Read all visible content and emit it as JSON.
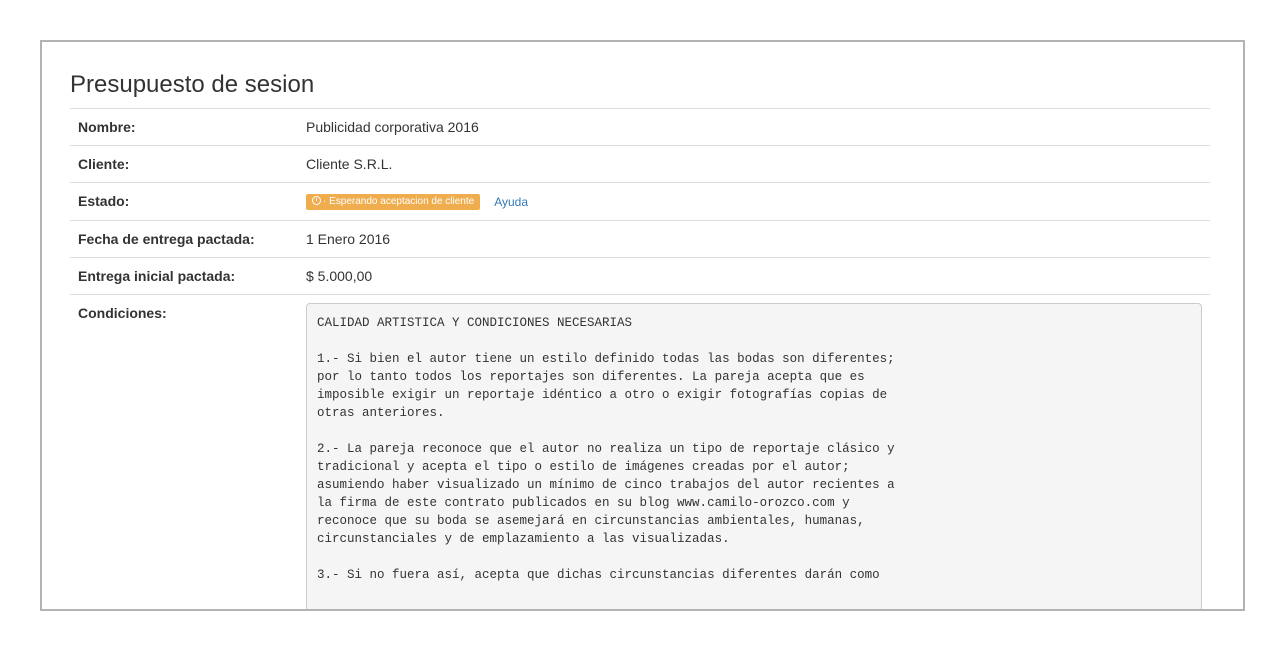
{
  "title": "Presupuesto de sesion",
  "rows": {
    "nombre": {
      "label": "Nombre:",
      "value": "Publicidad corporativa 2016"
    },
    "cliente": {
      "label": "Cliente:",
      "value": "Cliente S.R.L."
    },
    "estado": {
      "label": "Estado:",
      "badge_icon": "clock-icon",
      "badge_text": "· Esperando aceptacion de cliente",
      "badge_color": "#f0ad4e",
      "help_link": "Ayuda"
    },
    "fecha": {
      "label": "Fecha de entrega pactada:",
      "value": "1 Enero 2016"
    },
    "entrega": {
      "label": "Entrega inicial pactada:",
      "value": "$ 5.000,00"
    },
    "condiciones": {
      "label": "Condiciones:",
      "text": "CALIDAD ARTISTICA Y CONDICIONES NECESARIAS\n\n1.- Si bien el autor tiene un estilo definido todas las bodas son diferentes;\npor lo tanto todos los reportajes son diferentes. La pareja acepta que es\nimposible exigir un reportaje idéntico a otro o exigir fotografías copias de\notras anteriores.\n\n2.- La pareja reconoce que el autor no realiza un tipo de reportaje clásico y\ntradicional y acepta el tipo o estilo de imágenes creadas por el autor;\nasumiendo haber visualizado un mínimo de cinco trabajos del autor recientes a\nla firma de este contrato publicados en su blog www.camilo-orozco.com y\nreconoce que su boda se asemejará en circunstancias ambientales, humanas,\ncircunstanciales y de emplazamiento a las visualizadas.\n\n3.- Si no fuera así, acepta que dichas circunstancias diferentes darán como"
    }
  }
}
